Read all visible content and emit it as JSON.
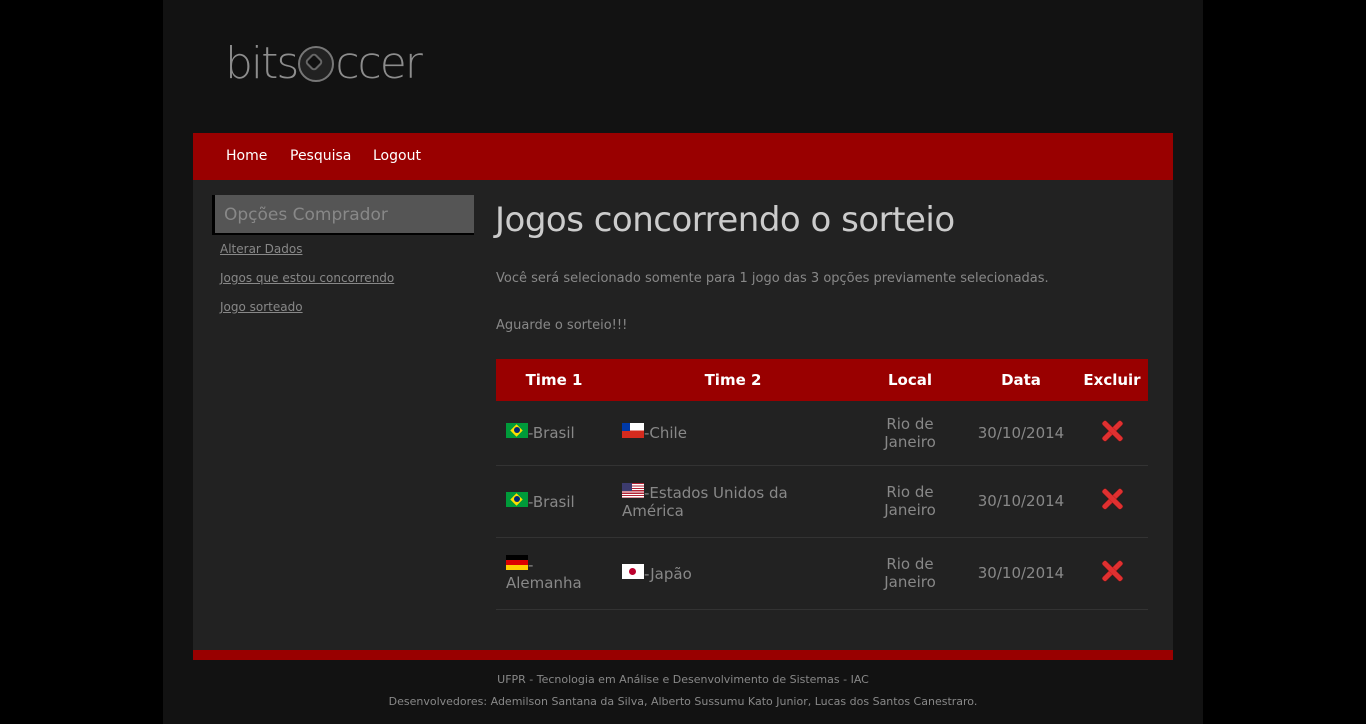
{
  "brand": {
    "logo_pre": "bits",
    "logo_post": "ccer"
  },
  "nav": {
    "items": [
      "Home",
      "Pesquisa",
      "Logout"
    ]
  },
  "sidebar": {
    "title": "Opções Comprador",
    "links": [
      "Alterar Dados",
      "Jogos que estou concorrendo",
      "Jogo sorteado"
    ]
  },
  "main": {
    "title": "Jogos concorrendo o sorteio",
    "info": "Você será selecionado somente para 1 jogo das 3 opções previamente selecionadas.",
    "wait": "Aguarde o sorteio!!!",
    "headers": [
      "Time 1",
      "Time 2",
      "Local",
      "Data",
      "Excluir"
    ],
    "rows": [
      {
        "team1": "-Brasil",
        "team1_flag": "brazil-flag",
        "team2": "-Chile",
        "team2_flag": "chile-flag",
        "local": "Rio de Janeiro",
        "date": "30/10/2014"
      },
      {
        "team1": "-Brasil",
        "team1_flag": "brazil-flag",
        "team2": "-Estados Unidos da América",
        "team2_flag": "usa-flag",
        "local": "Rio de Janeiro",
        "date": "30/10/2014"
      },
      {
        "team1": "-Alemanha",
        "team1_flag": "germany-flag",
        "team2": "-Japão",
        "team2_flag": "japan-flag",
        "local": "Rio de Janeiro",
        "date": "30/10/2014"
      }
    ]
  },
  "footer": {
    "line1": "UFPR - Tecnologia em Análise e Desenvolvimento de Sistemas - IAC",
    "line2": "Desenvolvedores: Ademilson Santana da Silva, Alberto Sussumu Kato Junior, Lucas dos Santos Canestraro."
  },
  "colors": {
    "brand_red": "#990000",
    "background": "#121212",
    "panel": "#222222",
    "delete_icon": "#e03030"
  }
}
